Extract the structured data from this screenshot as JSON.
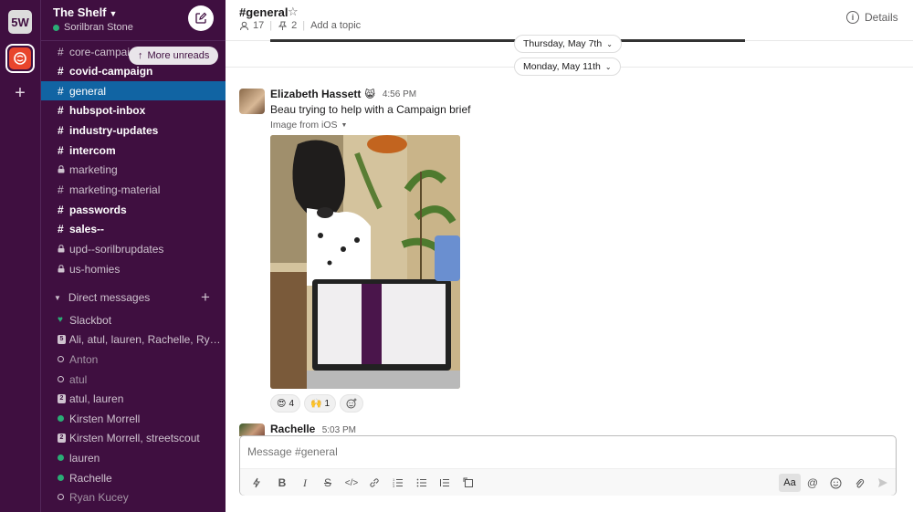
{
  "workspace": {
    "badge": "5W"
  },
  "team": {
    "name": "The Shelf",
    "user": "Sorilbran Stone"
  },
  "more_unreads": "More unreads",
  "channels": [
    {
      "name": "core-campaigns",
      "type": "hash",
      "bold": false
    },
    {
      "name": "covid-campaign",
      "type": "hash",
      "bold": true
    },
    {
      "name": "general",
      "type": "hash",
      "bold": false,
      "active": true
    },
    {
      "name": "hubspot-inbox",
      "type": "hash",
      "bold": true
    },
    {
      "name": "industry-updates",
      "type": "hash",
      "bold": true
    },
    {
      "name": "intercom",
      "type": "hash",
      "bold": true
    },
    {
      "name": "marketing",
      "type": "lock",
      "bold": false
    },
    {
      "name": "marketing-material",
      "type": "hash",
      "bold": false
    },
    {
      "name": "passwords",
      "type": "hash",
      "bold": true
    },
    {
      "name": "sales--",
      "type": "hash",
      "bold": true
    },
    {
      "name": "upd--sorilbrupdates",
      "type": "lock",
      "bold": false
    },
    {
      "name": "us-homies",
      "type": "lock",
      "bold": false
    }
  ],
  "dm_header": "Direct messages",
  "dms": [
    {
      "name": "Slackbot",
      "status": "heart"
    },
    {
      "name": "Ali, atul, lauren, Rachelle, Ryan...",
      "status": "group",
      "count": "5"
    },
    {
      "name": "Anton",
      "status": "away"
    },
    {
      "name": "atul",
      "status": "away"
    },
    {
      "name": "atul, lauren",
      "status": "group",
      "count": "2"
    },
    {
      "name": "Kirsten Morrell",
      "status": "online"
    },
    {
      "name": "Kirsten Morrell, streetscout",
      "status": "group",
      "count": "2"
    },
    {
      "name": "lauren",
      "status": "online"
    },
    {
      "name": "Rachelle",
      "status": "online"
    },
    {
      "name": "Ryan Kucey",
      "status": "away"
    }
  ],
  "channel": {
    "title": "#general",
    "members": "17",
    "pins": "2",
    "topic": "Add a topic",
    "details": "Details"
  },
  "dates": {
    "first": "Thursday, May 7th",
    "second": "Monday, May 11th"
  },
  "message": {
    "author": "Elizabeth Hassett",
    "time": "4:56 PM",
    "text": "Beau trying to help with a Campaign brief",
    "image_label": "Image from iOS"
  },
  "reactions": [
    {
      "emoji": "😍",
      "count": "4"
    },
    {
      "emoji": "🙌",
      "count": "1"
    }
  ],
  "message2": {
    "author": "Rachelle",
    "time": "5:03 PM"
  },
  "composer": {
    "placeholder": "Message #general",
    "aa": "Aa"
  }
}
